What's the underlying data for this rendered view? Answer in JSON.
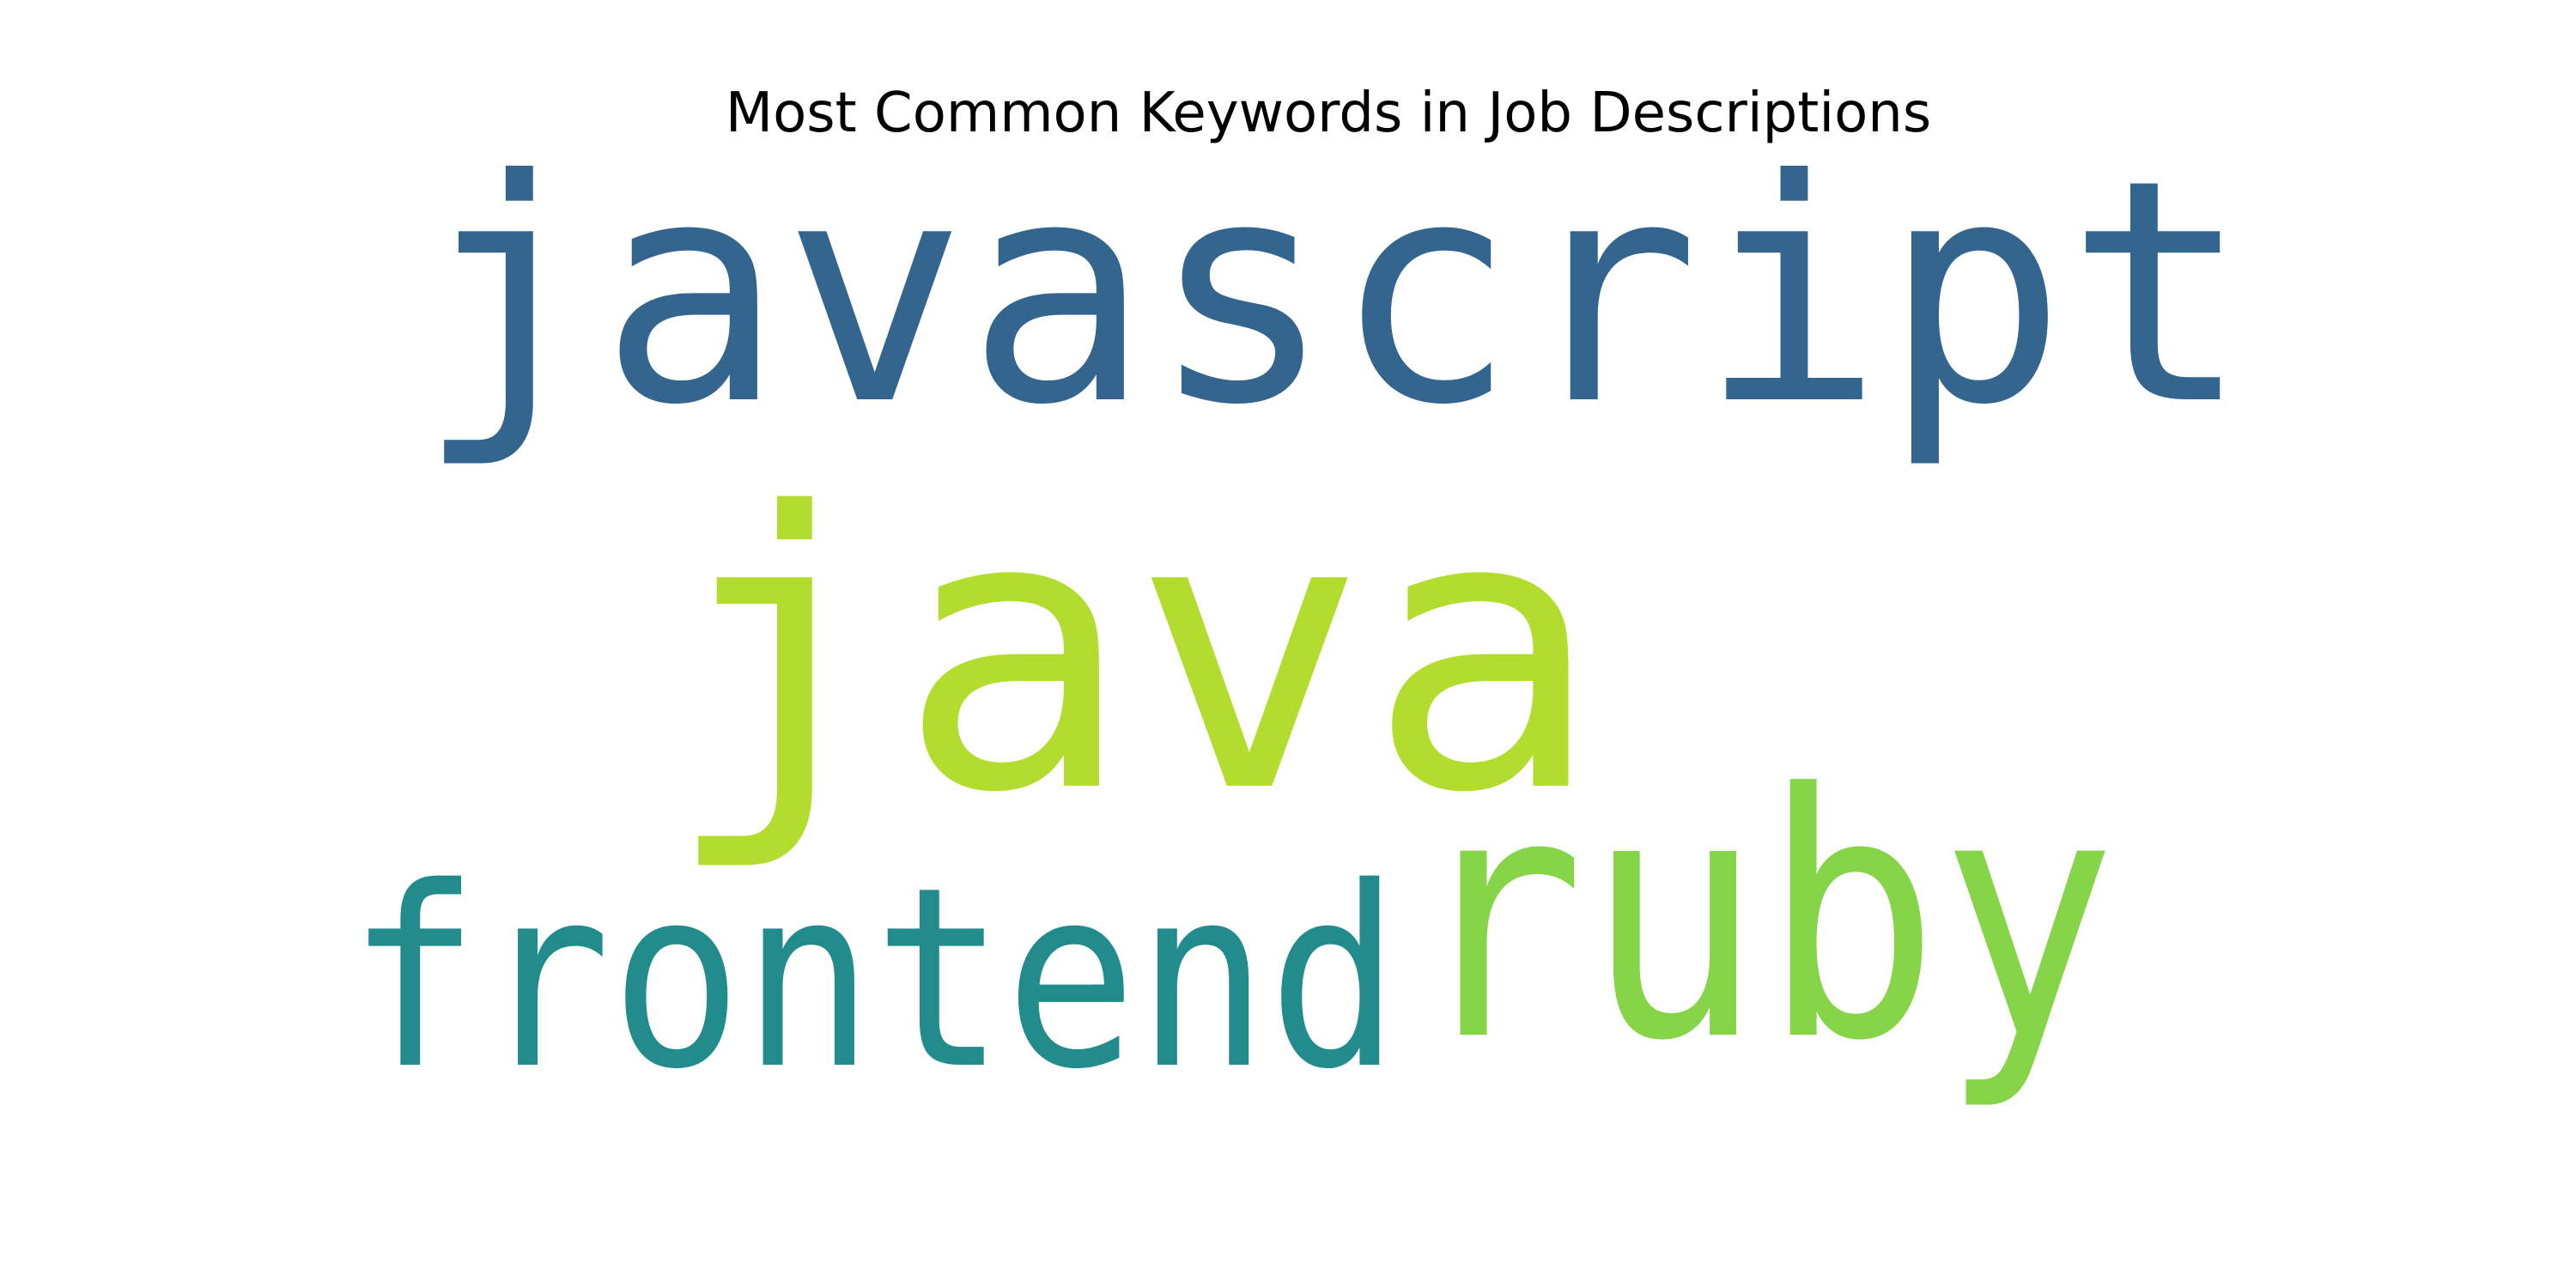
{
  "chart_data": {
    "type": "wordcloud",
    "title": "Most Common Keywords in Job Descriptions",
    "words": [
      {
        "text": "javascript",
        "weight": 1.0,
        "color": "#33658f"
      },
      {
        "text": "java",
        "weight": 1.0,
        "color": "#b2dd2f"
      },
      {
        "text": "ruby",
        "weight": 1.0,
        "color": "#86d549"
      },
      {
        "text": "frontend",
        "weight": 0.8,
        "color": "#228c8d"
      }
    ]
  }
}
